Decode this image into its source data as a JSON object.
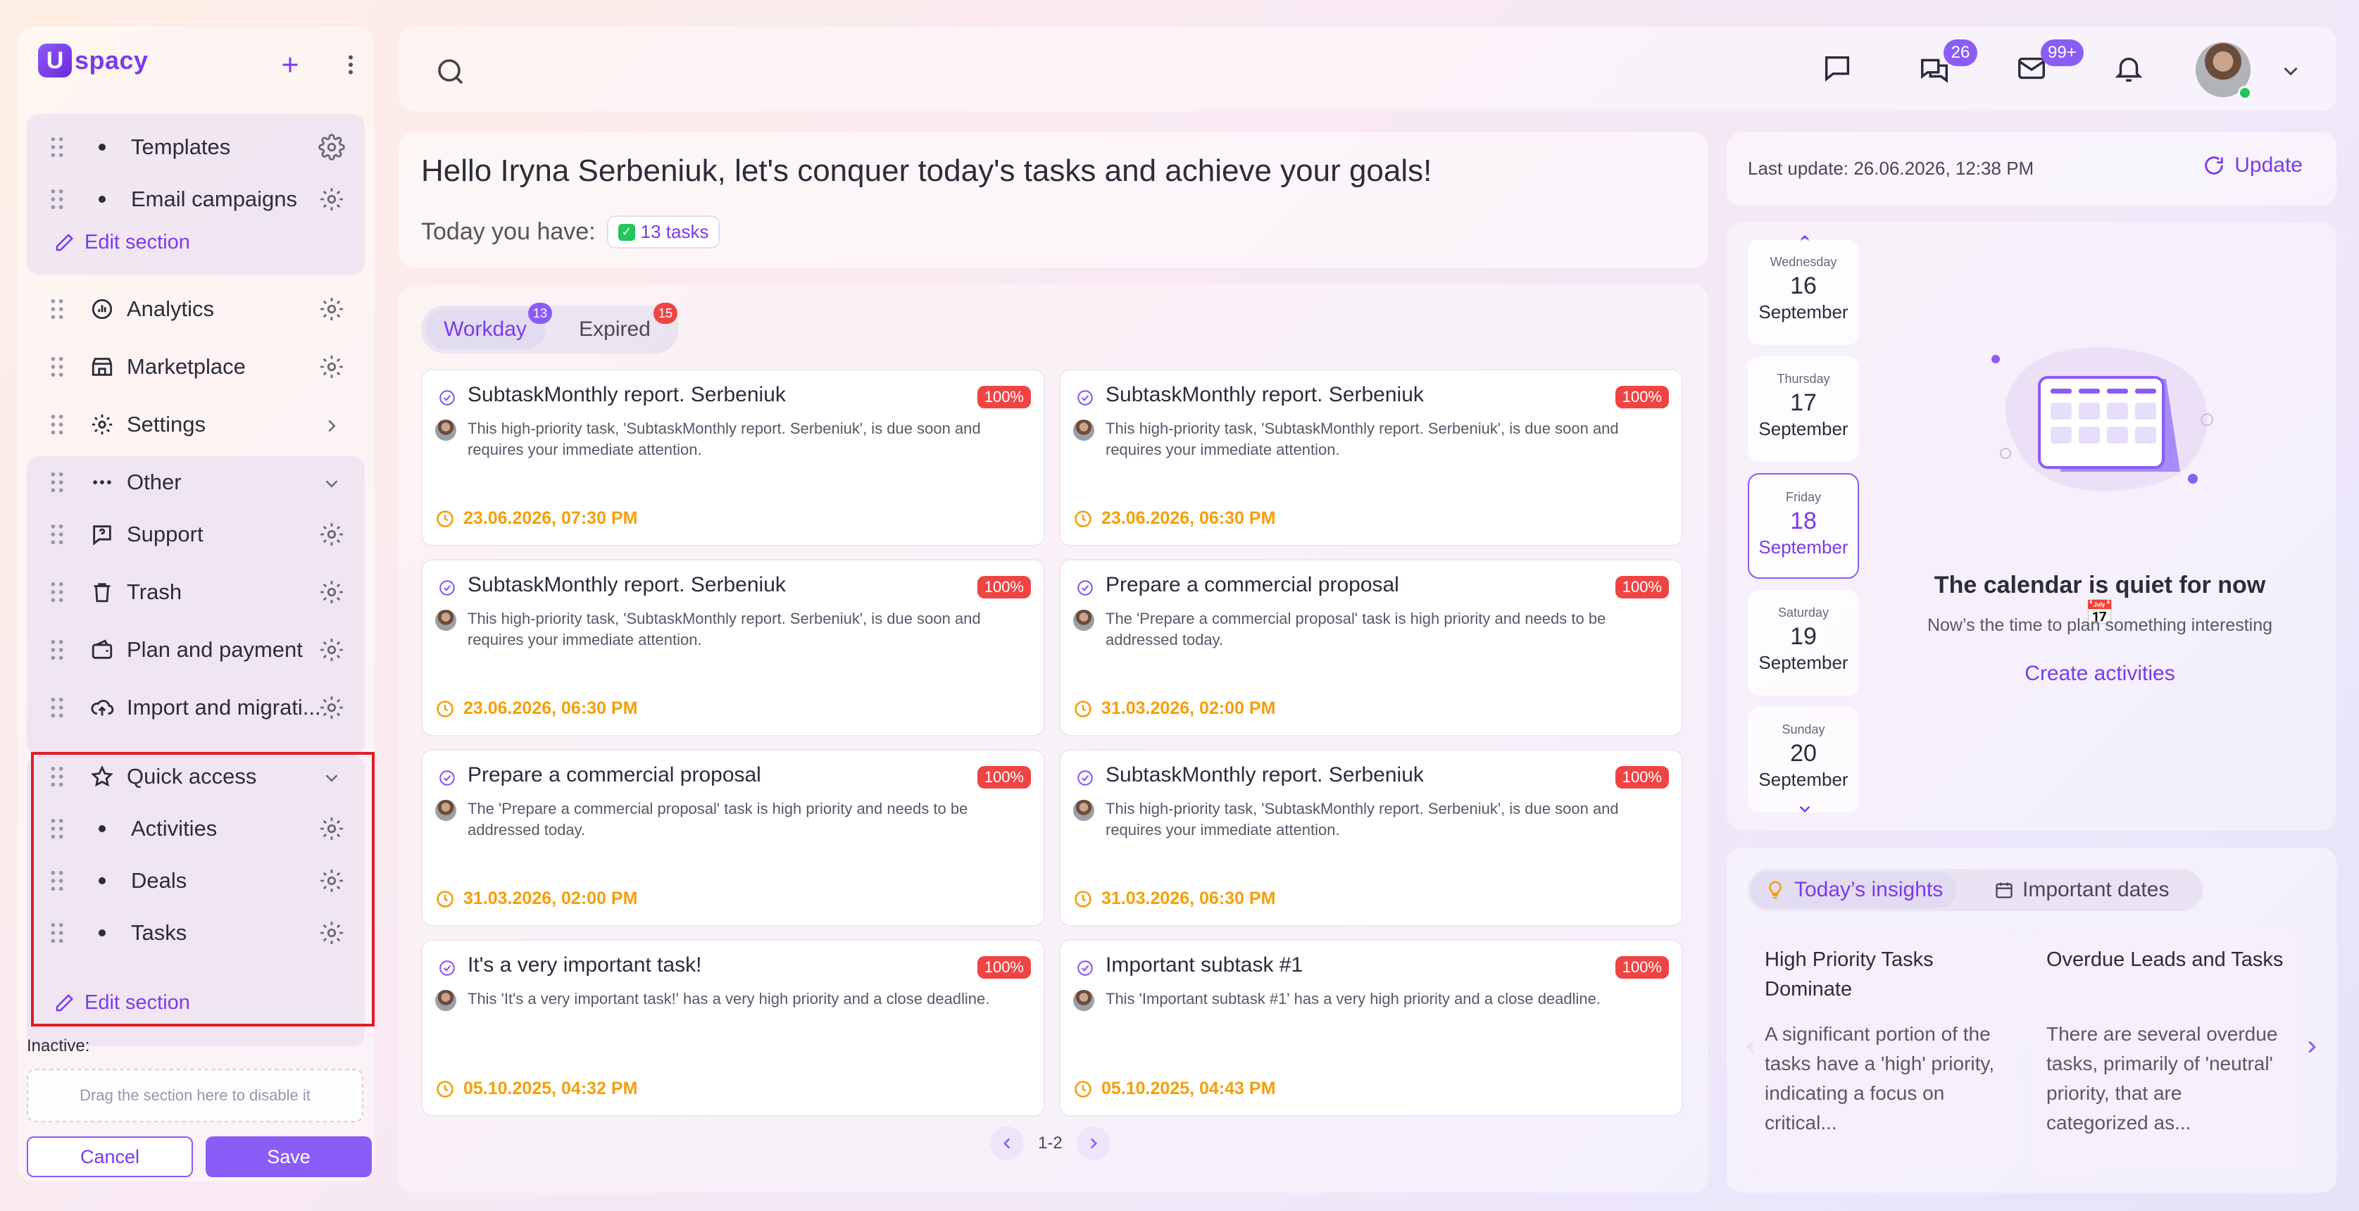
{
  "app": {
    "logo_letter": "U",
    "logo_text": "spacy"
  },
  "sidebar": {
    "group1": [
      {
        "label": "Templates",
        "type": "bullet"
      },
      {
        "label": "Email campaigns",
        "type": "bullet"
      }
    ],
    "edit_section_label": "Edit section",
    "main_items": [
      {
        "label": "Analytics",
        "icon": "analytics-icon"
      },
      {
        "label": "Marketplace",
        "icon": "marketplace-icon"
      },
      {
        "label": "Settings",
        "icon": "settings-icon"
      }
    ],
    "other": {
      "label": "Other",
      "items": [
        {
          "label": "Support",
          "icon": "support-icon"
        },
        {
          "label": "Trash",
          "icon": "trash-icon"
        },
        {
          "label": "Plan and payment",
          "icon": "wallet-icon"
        },
        {
          "label": "Import and migrati...",
          "icon": "upload-cloud-icon"
        }
      ]
    },
    "quick_access": {
      "label": "Quick access",
      "items": [
        {
          "label": "Activities"
        },
        {
          "label": "Deals"
        },
        {
          "label": "Tasks"
        }
      ],
      "edit_label": "Edit section"
    },
    "inactive_label": "Inactive:",
    "drop_hint": "Drag the section here to disable it",
    "cancel_label": "Cancel",
    "save_label": "Save"
  },
  "topbar": {
    "chat_badge": "26",
    "mail_badge": "99+"
  },
  "greeting": {
    "title": "Hello Iryna Serbeniuk, let's conquer today's tasks and achieve your goals!",
    "today_label": "Today you have:",
    "tasks_chip": "13 tasks"
  },
  "tasks": {
    "tabs": [
      {
        "label": "Workday",
        "badge": "13",
        "badge_color": "#8b5cf6"
      },
      {
        "label": "Expired",
        "badge": "15",
        "badge_color": "#ef4444"
      }
    ],
    "cards": [
      {
        "title": "SubtaskMonthly report. Serbeniuk",
        "pct": "100%",
        "desc": "This high-priority task, 'SubtaskMonthly report. Serbeniuk', is due soon and requires your immediate attention.",
        "date": "23.06.2026, 07:30 PM"
      },
      {
        "title": "SubtaskMonthly report. Serbeniuk",
        "pct": "100%",
        "desc": "This high-priority task, 'SubtaskMonthly report. Serbeniuk', is due soon and requires your immediate attention.",
        "date": "23.06.2026, 06:30 PM"
      },
      {
        "title": "SubtaskMonthly report. Serbeniuk",
        "pct": "100%",
        "desc": "This high-priority task, 'SubtaskMonthly report. Serbeniuk', is due soon and requires your immediate attention.",
        "date": "23.06.2026, 06:30 PM"
      },
      {
        "title": "Prepare a commercial proposal",
        "pct": "100%",
        "desc": "The 'Prepare a commercial proposal' task is high priority and needs to be addressed today.",
        "date": "31.03.2026, 02:00 PM"
      },
      {
        "title": "Prepare a commercial proposal",
        "pct": "100%",
        "desc": "The 'Prepare a commercial proposal' task is high priority and needs to be addressed today.",
        "date": "31.03.2026, 02:00 PM"
      },
      {
        "title": "SubtaskMonthly report. Serbeniuk",
        "pct": "100%",
        "desc": "This high-priority task, 'SubtaskMonthly report. Serbeniuk', is due soon and requires your immediate attention.",
        "date": "31.03.2026, 06:30 PM"
      },
      {
        "title": "It's a very important task!",
        "pct": "100%",
        "desc": "This 'It's a very important task!' has a very high priority and a close deadline.",
        "date": "05.10.2025, 04:32 PM"
      },
      {
        "title": "Important subtask #1",
        "pct": "100%",
        "desc": "This 'Important subtask #1' has a very high priority and a close deadline.",
        "date": "05.10.2025, 04:43 PM"
      }
    ],
    "pager": "1-2"
  },
  "right": {
    "last_update": "Last update: 26.06.2026, 12:38 PM",
    "update_label": "Update",
    "days": [
      {
        "name": "Wednesday",
        "num": "16",
        "month": "September"
      },
      {
        "name": "Thursday",
        "num": "17",
        "month": "September"
      },
      {
        "name": "Friday",
        "num": "18",
        "month": "September"
      },
      {
        "name": "Saturday",
        "num": "19",
        "month": "September"
      },
      {
        "name": "Sunday",
        "num": "20",
        "month": "September"
      }
    ],
    "quiet_title": "The calendar is quiet for now 📅",
    "quiet_sub": "Now’s the time to plan something interesting",
    "create_label": "Create activities",
    "insights_tab": "Today’s insights",
    "dates_tab": "Important dates",
    "insights": [
      {
        "title": "High Priority Tasks Dominate",
        "body": "A significant portion of the tasks have a 'high' priority, indicating a focus on critical..."
      },
      {
        "title": "Overdue Leads and Tasks",
        "body": "There are several overdue tasks, primarily of 'neutral' priority, that are categorized as..."
      }
    ]
  },
  "colors": {
    "accent": "#8b5cf6",
    "danger": "#ef4444",
    "warning": "#f59e0b",
    "highlight_border": "#e11d2a"
  }
}
